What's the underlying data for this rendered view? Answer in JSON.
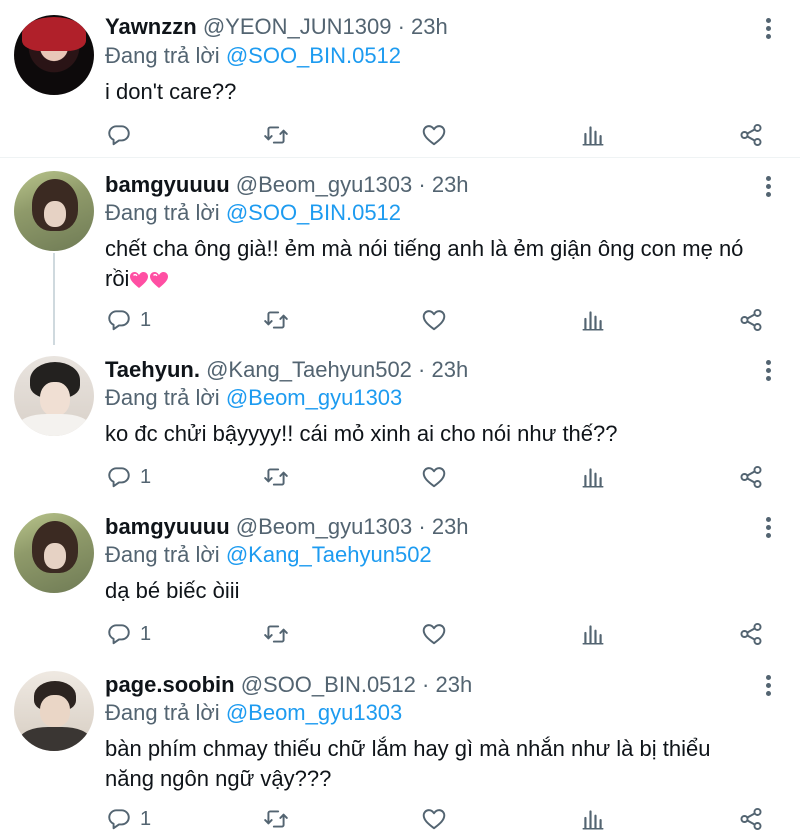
{
  "tweets": [
    {
      "name": "Yawnzzn",
      "handle": "@YEON_JUN1309",
      "time": "23h",
      "reply_prefix": "Đang trả lời",
      "reply_to": "@SOO_BIN.0512",
      "text": "i don't care??",
      "reply_count": ""
    },
    {
      "name": "bamgyuuuu",
      "handle": "@Beom_gyu1303",
      "time": "23h",
      "reply_prefix": "Đang trả lời",
      "reply_to": "@SOO_BIN.0512",
      "text_line1": "chết cha ông già!! ẻm mà nói tiếng anh là ẻm giận ông con mẹ nó",
      "text_line2": "rồi",
      "reply_count": "1"
    },
    {
      "name": "Taehyun.",
      "handle": "@Kang_Taehyun502",
      "time": "23h",
      "reply_prefix": "Đang trả lời",
      "reply_to": "@Beom_gyu1303",
      "text": "ko đc chửi bậyyyy!! cái mỏ xinh ai cho nói như thế??",
      "reply_count": "1"
    },
    {
      "name": "bamgyuuuu",
      "handle": "@Beom_gyu1303",
      "time": "23h",
      "reply_prefix": "Đang trả lời",
      "reply_to": "@Kang_Taehyun502",
      "text": "dạ bé biếc òiii",
      "reply_count": "1"
    },
    {
      "name": "page.soobin",
      "handle": "@SOO_BIN.0512",
      "time": "23h",
      "reply_prefix": "Đang trả lời",
      "reply_to": "@Beom_gyu1303",
      "text_line1": "bàn phím chmay thiếu chữ lắm hay gì mà nhắn như là bị thiểu",
      "text_line2": "năng ngôn ngữ vậy???",
      "reply_count": "1"
    }
  ],
  "separator": "·",
  "icons": {
    "reply": "reply-icon",
    "retweet": "retweet-icon",
    "like": "heart-icon",
    "analytics": "analytics-icon",
    "share": "share-icon",
    "more": "more-vertical-icon"
  },
  "colors": {
    "mention": "#1d9bf0",
    "secondary_text": "#536471",
    "emoji_heart": "#ff4fa3"
  }
}
